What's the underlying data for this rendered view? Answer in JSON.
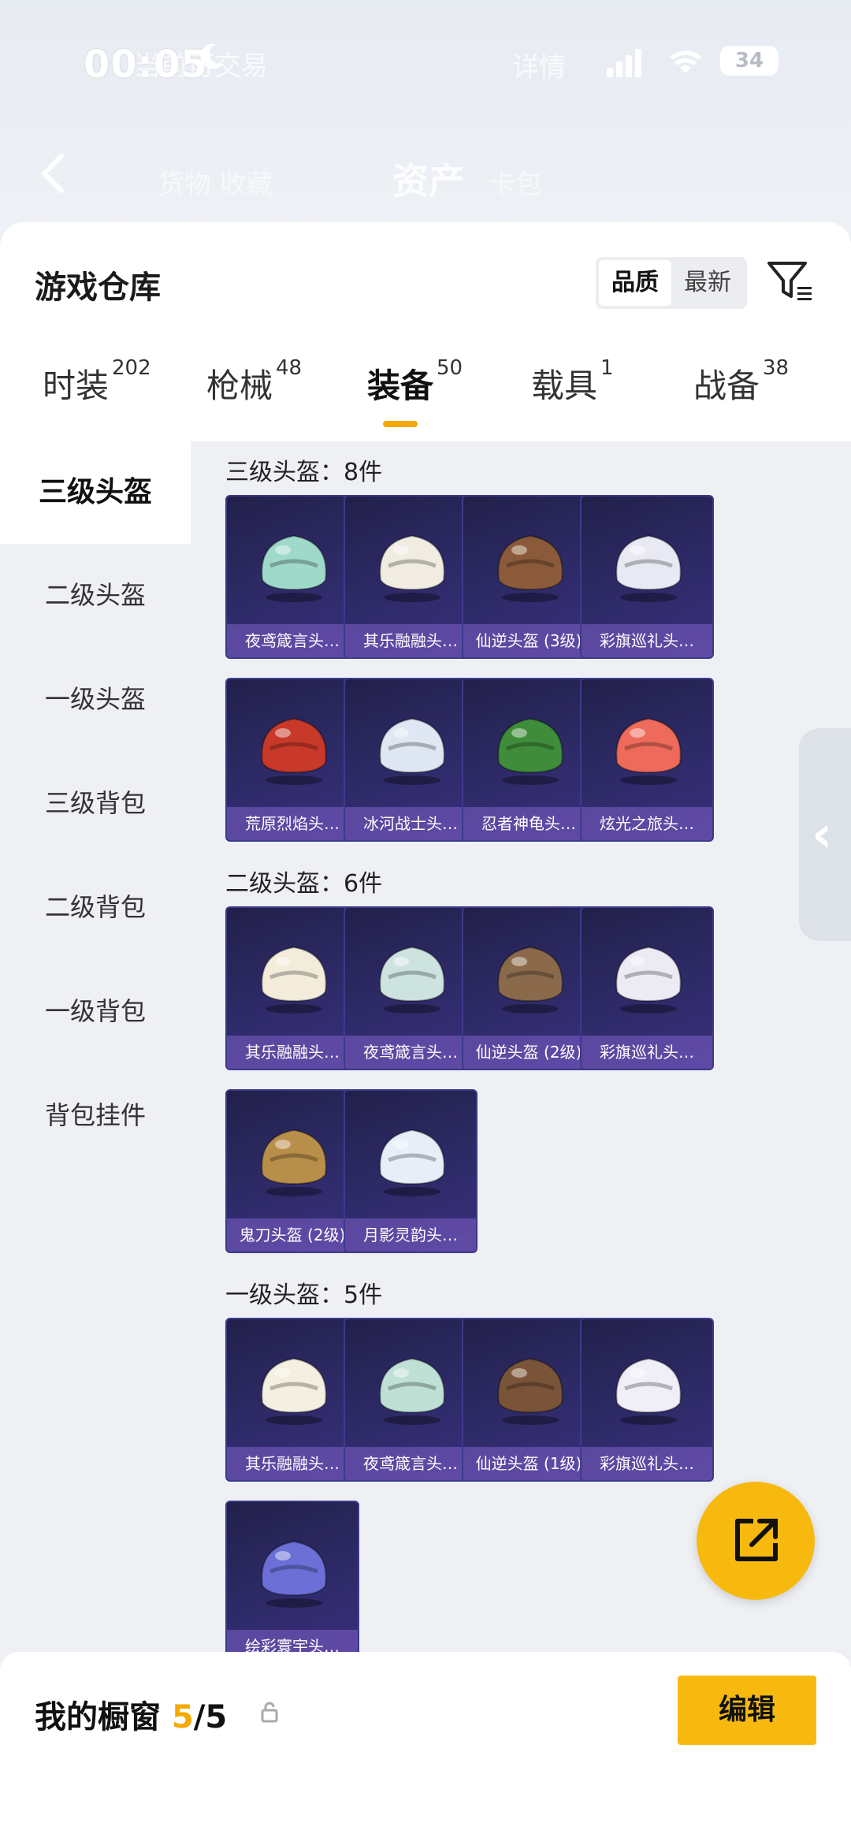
{
  "status": {
    "time": "00:05",
    "battery": "34"
  },
  "header": {
    "title": "资产",
    "ghost_left": "货物  收藏",
    "ghost_right": "卡包",
    "top_ghost_left": "当前可交易",
    "top_ghost_right": "详情"
  },
  "sheet": {
    "title": "游戏仓库",
    "sort": {
      "quality": "品质",
      "latest": "最新"
    }
  },
  "tabs": [
    {
      "label": "时装",
      "count": "202"
    },
    {
      "label": "枪械",
      "count": "48"
    },
    {
      "label": "装备",
      "count": "50"
    },
    {
      "label": "载具",
      "count": "1"
    },
    {
      "label": "战备",
      "count": "38"
    }
  ],
  "categories": [
    "三级头盔",
    "二级头盔",
    "一级头盔",
    "三级背包",
    "二级背包",
    "一级背包",
    "背包挂件"
  ],
  "groups": [
    {
      "heading": "三级头盔：8件",
      "items": [
        {
          "name": "夜鸢箴言头…",
          "icon": "helmet-icon",
          "color": "#9fd9c9"
        },
        {
          "name": "其乐融融头…",
          "icon": "helmet-icon",
          "color": "#f1ece2"
        },
        {
          "name": "仙逆头盔 (3级)",
          "icon": "helmet-icon",
          "color": "#8a5a3a"
        },
        {
          "name": "彩旗巡礼头…",
          "icon": "helmet-icon",
          "color": "#e9e9f4"
        },
        {
          "name": "荒原烈焰头…",
          "icon": "helmet-icon",
          "color": "#c8392a"
        },
        {
          "name": "冰河战士头…",
          "icon": "helmet-icon",
          "color": "#dfe7f2"
        },
        {
          "name": "忍者神龟头…",
          "icon": "helmet-icon",
          "color": "#3f8d3a"
        },
        {
          "name": "炫光之旅头…",
          "icon": "helmet-icon",
          "color": "#ee6a5a"
        }
      ]
    },
    {
      "heading": "二级头盔：6件",
      "items": [
        {
          "name": "其乐融融头…",
          "icon": "helmet-icon",
          "color": "#f3ecdb"
        },
        {
          "name": "夜鸢箴言头…",
          "icon": "helmet-icon",
          "color": "#cde3df"
        },
        {
          "name": "仙逆头盔 (2级)",
          "icon": "helmet-icon",
          "color": "#8b6a4c"
        },
        {
          "name": "彩旗巡礼头…",
          "icon": "helmet-icon",
          "color": "#eceaf3"
        },
        {
          "name": "鬼刀头盔 (2级)",
          "icon": "helmet-icon",
          "color": "#b88f4a"
        },
        {
          "name": "月影灵韵头…",
          "icon": "helmet-icon",
          "color": "#e8eef8"
        }
      ]
    },
    {
      "heading": "一级头盔：5件",
      "items": [
        {
          "name": "其乐融融头…",
          "icon": "helmet-icon",
          "color": "#f4efe1"
        },
        {
          "name": "夜鸢箴言头…",
          "icon": "helmet-icon",
          "color": "#bfe0d4"
        },
        {
          "name": "仙逆头盔 (1级)",
          "icon": "helmet-icon",
          "color": "#7a5438"
        },
        {
          "name": "彩旗巡礼头…",
          "icon": "helmet-icon",
          "color": "#f0eef6"
        },
        {
          "name": "绘彩寰宇头…",
          "icon": "helmet-icon",
          "color": "#6b6fd6"
        }
      ]
    }
  ],
  "bottom": {
    "label": "我的橱窗",
    "current": "5",
    "total": "/5",
    "edit": "编辑"
  },
  "colors": {
    "accent": "#f5a800",
    "tile_bg": "#2d2a66"
  }
}
